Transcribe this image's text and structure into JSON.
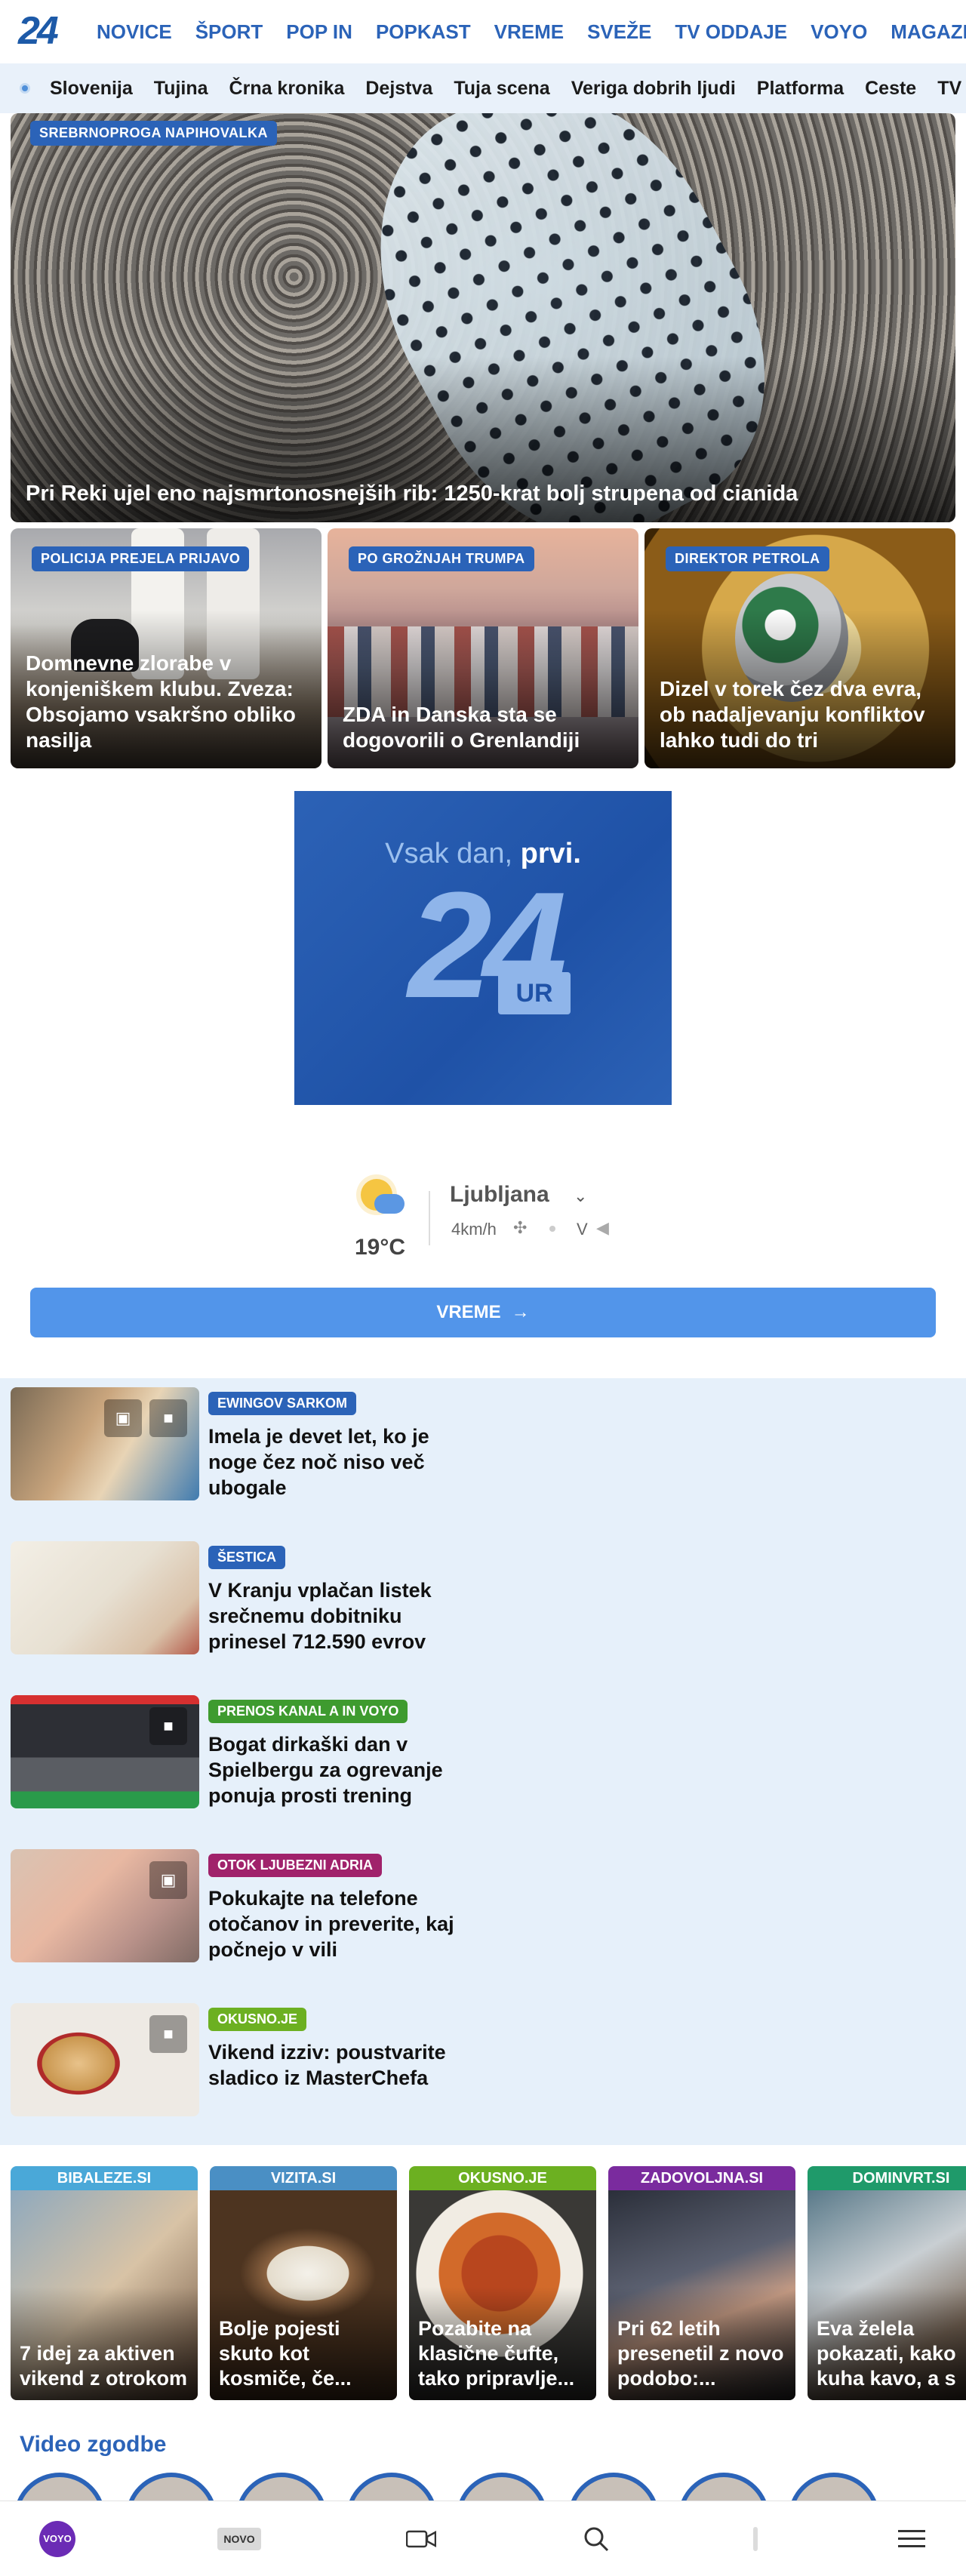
{
  "logo": {
    "text": "24",
    "alt": "24ur"
  },
  "nav": {
    "items": [
      "NOVICE",
      "ŠPORT",
      "POP IN",
      "POPKAST",
      "VREME",
      "SVEŽE",
      "TV ODDAJE",
      "VOYO",
      "MAGAZIN"
    ]
  },
  "subnav": {
    "items": [
      "Slovenija",
      "Tujina",
      "Črna kronika",
      "Dejstva",
      "Tuja scena",
      "Veriga dobrih ljudi",
      "Platforma",
      "Ceste",
      "TV spor"
    ]
  },
  "hero": {
    "badge": "SREBRNOPROGA NAPIHOVALKA",
    "title": "Pri Reki ujel eno najsmrtonosnejših rib: 1250-krat bolj strupena od cianida"
  },
  "cards": [
    {
      "badge": "POLICIJA PREJELA PRIJAVO",
      "title": "Domnevne zlorabe v konjeniškem klubu. Zveza: Obsojamo vsakršno obliko nasilja"
    },
    {
      "badge": "PO GROŽNJAH TRUMPA",
      "title": "ZDA in Danska sta se dogovorili o Grenlandiji"
    },
    {
      "badge": "DIREKTOR PETROLA",
      "title": "Dizel v torek čez dva evra, ob nadaljevanju konfliktov lahko tudi do tri"
    }
  ],
  "ad": {
    "line_prefix": "Vsak dan,",
    "line_bold": "prvi.",
    "number": "24",
    "suffix": "UR"
  },
  "weather": {
    "temperature": "19°C",
    "city": "Ljubljana",
    "wind_speed": "4km/h",
    "wind_direction": "V",
    "button_label": "VREME",
    "icons": {
      "condition": "partly-sunny-icon",
      "wind": "fan-icon",
      "direction": "arrow-icon"
    }
  },
  "articles": [
    {
      "badge": "EWINGOV SARKOM",
      "badge_color": "#2b63b8",
      "title": "Imela je devet let, ko je noge čez noč niso več ubogale",
      "icons": [
        "gallery-icon",
        "video-icon"
      ]
    },
    {
      "badge": "ŠESTICA",
      "badge_color": "#2b63b8",
      "title": "V Kranju vplačan listek srečnemu dobitniku prinesel 712.590 evrov",
      "icons": []
    },
    {
      "badge": "PRENOS KANAL A IN VOYO",
      "badge_color": "#3e9b2f",
      "title": "Bogat dirkaški dan v Spielbergu za ogrevanje ponuja prosti trening",
      "icons": [
        "video-icon"
      ]
    },
    {
      "badge": "OTOK LJUBEZNI ADRIA",
      "badge_color": "#a0226b",
      "title": "Pokukajte na telefone otočanov in preverite, kaj počnejo v vili",
      "icons": [
        "gallery-icon"
      ]
    },
    {
      "badge": "OKUSNO.JE",
      "badge_color": "#6cb021",
      "title": "Vikend izziv: poustvarite sladico iz MasterChefa",
      "icons": [
        "video-icon"
      ]
    }
  ],
  "partners": [
    {
      "source": "BIBALEZE.SI",
      "color": "#4aa8d8",
      "title": "7 idej za aktiven vikend z otrokom"
    },
    {
      "source": "VIZITA.SI",
      "color": "#4a8fc4",
      "title": "Bolje pojesti skuto kot kosmiče, če..."
    },
    {
      "source": "OKUSNO.JE",
      "color": "#6cb021",
      "title": "Pozabite na klasične čufte, tako pripravlje..."
    },
    {
      "source": "ZADOVOLJNA.SI",
      "color": "#7a2b9e",
      "title": "Pri 62 letih presenetil z novo podobo:..."
    },
    {
      "source": "DOMINVRT.SI",
      "color": "#1f9a6a",
      "title": "Eva želela pokazati, kako kuha kavo, a s"
    }
  ],
  "video_stories": {
    "title": "Video zgodbe",
    "count": 8
  },
  "bottom_bar": {
    "voyo_label": "VOYO",
    "novo_label": "NOVO",
    "icons": [
      "voyo-icon",
      "novo-icon",
      "video-camera-icon",
      "search-icon",
      "divider-icon",
      "menu-icon"
    ]
  }
}
